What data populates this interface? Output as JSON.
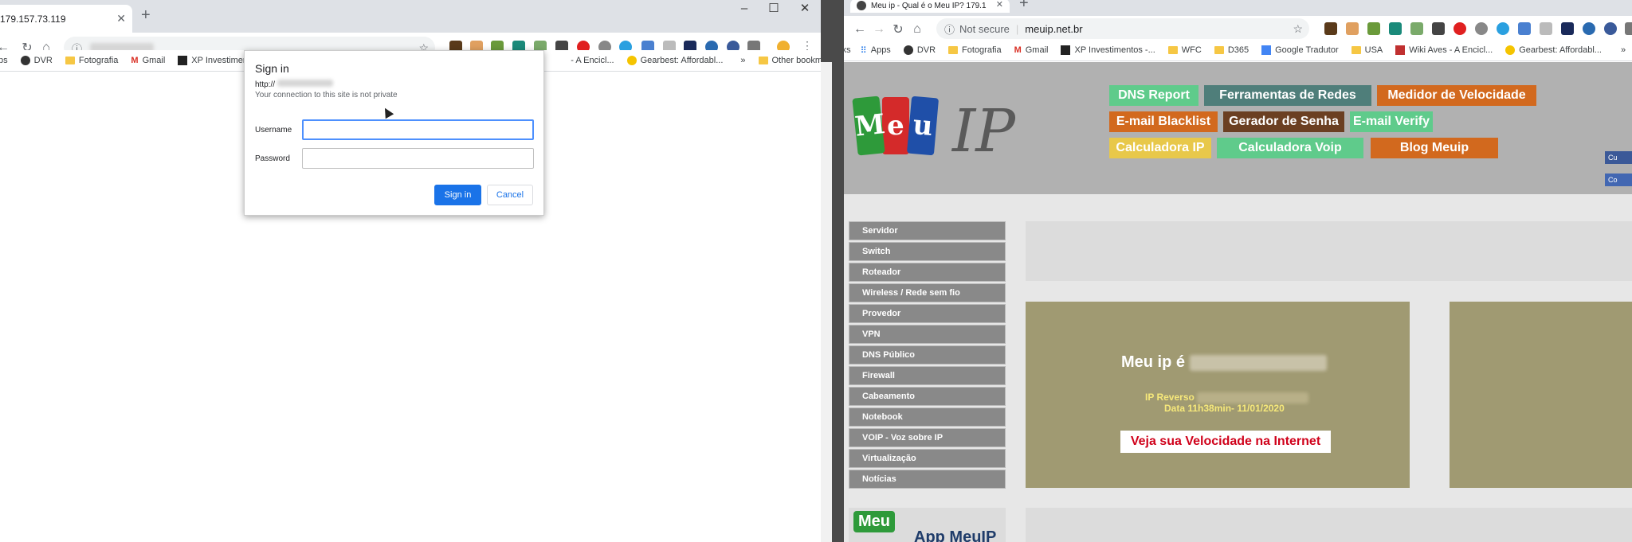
{
  "left": {
    "tab_title": "179.157.73.119",
    "new_tab": "+",
    "controls": {
      "minimize": "–",
      "maximize": "☐",
      "close": "✕"
    },
    "bookmarks": [
      "DVR",
      "Fotografia",
      "Gmail",
      "XP Investimento",
      "- A Encicl...",
      "Gearbest: Affordabl...",
      "Other bookmarks"
    ],
    "bm_left_partial": "ps",
    "overflow": "»"
  },
  "dialog": {
    "title": "Sign in",
    "url_prefix": "http://",
    "note": "Your connection to this site is not private",
    "username_label": "Username",
    "password_label": "Password",
    "signin": "Sign in",
    "cancel": "Cancel"
  },
  "right": {
    "tab_title": "Meu ip - Qual é o Meu IP? 179.1",
    "new_tab": "+",
    "not_secure": "Not secure",
    "url": "meuip.net.br",
    "bookmarks": [
      "Apps",
      "DVR",
      "Fotografia",
      "Gmail",
      "XP Investimentos -...",
      "WFC",
      "D365",
      "Google Tradutor",
      "USA",
      "Wiki Aves - A Encicl...",
      "Gearbest: Affordabl..."
    ],
    "bm_left_partial": "rks",
    "overflow": "»",
    "logo_letters": [
      "M",
      "e",
      "u"
    ],
    "logo_ip": "IP",
    "nav": [
      {
        "label": "DNS Report",
        "color": "#5fcb8b"
      },
      {
        "label": "Ferramentas de Redes",
        "color": "#4f7e7a"
      },
      {
        "label": "Medidor de Velocidade",
        "color": "#d2691e"
      },
      {
        "label": "E-mail Blacklist",
        "color": "#d2691e"
      },
      {
        "label": "Gerador de Senha",
        "color": "#6b3f22"
      },
      {
        "label": "E-mail Verify",
        "color": "#5fcb8b"
      },
      {
        "label": "Calculadora IP",
        "color": "#e8c84a"
      },
      {
        "label": "Calculadora Voip",
        "color": "#5fcb8b"
      },
      {
        "label": "Blog Meuip",
        "color": "#d2691e"
      }
    ],
    "social": [
      "Cu",
      "Co"
    ],
    "sidebar": [
      "Servidor",
      "Switch",
      "Roteador",
      "Wireless / Rede sem fio",
      "Provedor",
      "VPN",
      "DNS Público",
      "Firewall",
      "Cabeamento",
      "Notebook",
      "VOIP - Voz sobre IP",
      "Virtualização",
      "Notícias"
    ],
    "my_ip_label": "Meu ip é",
    "reverse_label": "IP Reverso",
    "date_text": "Data 11h38min- 11/01/2020",
    "speed_button": "Veja sua Velocidade na Internet",
    "app_logo": "Meu",
    "app_label": "App MeuIP"
  }
}
